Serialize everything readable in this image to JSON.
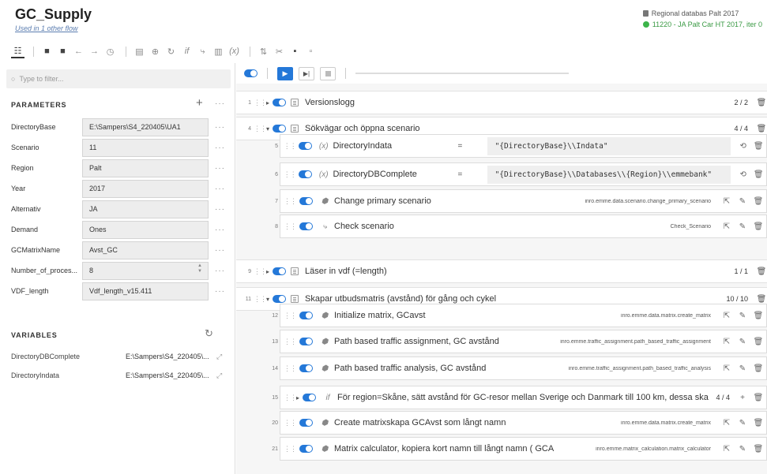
{
  "header": {
    "title": "GC_Supply",
    "subtitle": "Used in 1 other flow",
    "database": "Regional databas Palt 2017",
    "scenario": "11220 - JA Palt Car HT 2017, iter 0"
  },
  "filter": {
    "placeholder": "Type to filter..."
  },
  "parameters": {
    "title": "PARAMETERS",
    "items": [
      {
        "label": "DirectoryBase",
        "value": "E:\\Sampers\\S4_220405\\UA1"
      },
      {
        "label": "Scenario",
        "value": "11"
      },
      {
        "label": "Region",
        "value": "Palt"
      },
      {
        "label": "Year",
        "value": "2017"
      },
      {
        "label": "Alternativ",
        "value": "JA"
      },
      {
        "label": "Demand",
        "value": "Ones"
      },
      {
        "label": "GCMatrixName",
        "value": "Avst_GC"
      },
      {
        "label": "Number_of_proces...",
        "value": "8"
      },
      {
        "label": "VDF_length",
        "value": "Vdf_length_v15.411"
      }
    ]
  },
  "variables": {
    "title": "VARIABLES",
    "items": [
      {
        "name": "DirectoryDBComplete",
        "value": "E:\\Sampers\\S4_220405\\..."
      },
      {
        "name": "DirectoryIndata",
        "value": "E:\\Sampers\\S4_220405\\..."
      }
    ]
  },
  "flow": {
    "groups": [
      {
        "num": "1",
        "title": "Versionslogg",
        "count": "2 / 2"
      },
      {
        "num": "4",
        "title": "Sökvägar och öppna scenario",
        "count": "4 / 4"
      },
      {
        "num": "9",
        "title": "Läser in vdf (=length)",
        "count": "1 / 1"
      },
      {
        "num": "11",
        "title": "Skapar utbudsmatris (avstånd) för gång och cykel",
        "count": "10 / 10"
      }
    ],
    "children": [
      {
        "num": "5",
        "title": "DirectoryIndata",
        "expr": "\"{DirectoryBase}\\\\Indata\""
      },
      {
        "num": "6",
        "title": "DirectoryDBComplete",
        "expr": "\"{DirectoryBase}\\\\Databases\\\\{Region}\\\\emmebank\""
      },
      {
        "num": "7",
        "title": "Change primary scenario",
        "path": "inro.emme.data.scenario.change_primary_scenario"
      },
      {
        "num": "8",
        "title": "Check scenario",
        "path": "Check_Scenario"
      },
      {
        "num": "12",
        "title": "Initialize matrix, GCavst",
        "path": "inro.emme.data.matrix.create_matrix"
      },
      {
        "num": "13",
        "title": "Path based traffic assignment, GC avstånd",
        "path": "inro.emme.traffic_assignment.path_based_traffic_assignment"
      },
      {
        "num": "14",
        "title": "Path based traffic analysis, GC avstånd",
        "path": "inro.emme.traffic_assignment.path_based_traffic_analysis"
      },
      {
        "num": "15",
        "title": "För region=Skåne, sätt avstånd för GC-resor mellan Sverige och Danmark till 100 km, dessa ska",
        "count": "4 / 4"
      },
      {
        "num": "20",
        "title": "Create matrixskapa GCAvst som långt namn",
        "path": "inro.emme.data.matrix.create_matrix"
      },
      {
        "num": "21",
        "title": "Matrix calculator, kopiera kort namn till långt namn ( GCA",
        "path": "inro.emme.matrix_calculation.matrix_calculator"
      }
    ],
    "equals": "="
  }
}
